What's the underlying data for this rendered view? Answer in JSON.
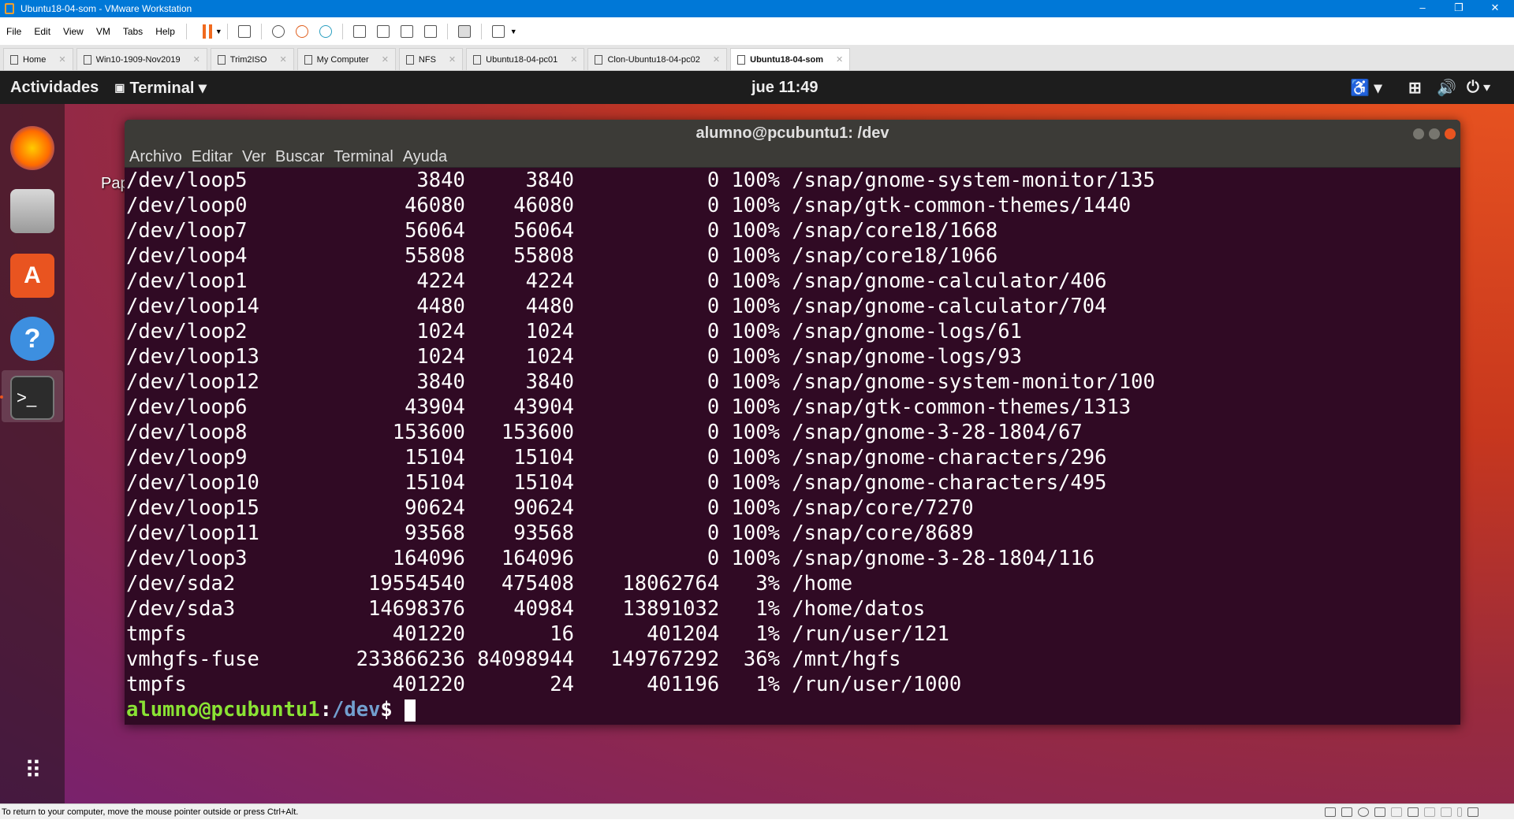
{
  "window": {
    "title": "Ubuntu18-04-som - VMware Workstation"
  },
  "menu": [
    "File",
    "Edit",
    "View",
    "VM",
    "Tabs",
    "Help"
  ],
  "tabs": [
    {
      "label": "Home"
    },
    {
      "label": "Win10-1909-Nov2019"
    },
    {
      "label": "Trim2ISO"
    },
    {
      "label": "My Computer"
    },
    {
      "label": "NFS"
    },
    {
      "label": "Ubuntu18-04-pc01"
    },
    {
      "label": "Clon-Ubuntu18-04-pc02"
    },
    {
      "label": "Ubuntu18-04-som",
      "active": true
    }
  ],
  "topbar": {
    "activities": "Actividades",
    "app": "Terminal ▾",
    "clock": "jue 11:49"
  },
  "desktop": {
    "icon_label": "Pap"
  },
  "terminal": {
    "title": "alumno@pcubuntu1: /dev",
    "menu": [
      "Archivo",
      "Editar",
      "Ver",
      "Buscar",
      "Terminal",
      "Ayuda"
    ],
    "rows": [
      [
        "/dev/loop5",
        "3840",
        "3840",
        "0",
        "100%",
        "/snap/gnome-system-monitor/135"
      ],
      [
        "/dev/loop0",
        "46080",
        "46080",
        "0",
        "100%",
        "/snap/gtk-common-themes/1440"
      ],
      [
        "/dev/loop7",
        "56064",
        "56064",
        "0",
        "100%",
        "/snap/core18/1668"
      ],
      [
        "/dev/loop4",
        "55808",
        "55808",
        "0",
        "100%",
        "/snap/core18/1066"
      ],
      [
        "/dev/loop1",
        "4224",
        "4224",
        "0",
        "100%",
        "/snap/gnome-calculator/406"
      ],
      [
        "/dev/loop14",
        "4480",
        "4480",
        "0",
        "100%",
        "/snap/gnome-calculator/704"
      ],
      [
        "/dev/loop2",
        "1024",
        "1024",
        "0",
        "100%",
        "/snap/gnome-logs/61"
      ],
      [
        "/dev/loop13",
        "1024",
        "1024",
        "0",
        "100%",
        "/snap/gnome-logs/93"
      ],
      [
        "/dev/loop12",
        "3840",
        "3840",
        "0",
        "100%",
        "/snap/gnome-system-monitor/100"
      ],
      [
        "/dev/loop6",
        "43904",
        "43904",
        "0",
        "100%",
        "/snap/gtk-common-themes/1313"
      ],
      [
        "/dev/loop8",
        "153600",
        "153600",
        "0",
        "100%",
        "/snap/gnome-3-28-1804/67"
      ],
      [
        "/dev/loop9",
        "15104",
        "15104",
        "0",
        "100%",
        "/snap/gnome-characters/296"
      ],
      [
        "/dev/loop10",
        "15104",
        "15104",
        "0",
        "100%",
        "/snap/gnome-characters/495"
      ],
      [
        "/dev/loop15",
        "90624",
        "90624",
        "0",
        "100%",
        "/snap/core/7270"
      ],
      [
        "/dev/loop11",
        "93568",
        "93568",
        "0",
        "100%",
        "/snap/core/8689"
      ],
      [
        "/dev/loop3",
        "164096",
        "164096",
        "0",
        "100%",
        "/snap/gnome-3-28-1804/116"
      ],
      [
        "/dev/sda2",
        "19554540",
        "475408",
        "18062764",
        "3%",
        "/home"
      ],
      [
        "/dev/sda3",
        "14698376",
        "40984",
        "13891032",
        "1%",
        "/home/datos"
      ],
      [
        "tmpfs",
        "401220",
        "16",
        "401204",
        "1%",
        "/run/user/121"
      ],
      [
        "vmhgfs-fuse",
        "233866236",
        "84098944",
        "149767292",
        "36%",
        "/mnt/hgfs"
      ],
      [
        "tmpfs",
        "401220",
        "24",
        "401196",
        "1%",
        "/run/user/1000"
      ]
    ],
    "prompt": {
      "user": "alumno@pcubuntu1",
      "sep": ":",
      "path": "/dev",
      "symbol": "$ "
    }
  },
  "statusbar": {
    "text": "To return to your computer, move the mouse pointer outside or press Ctrl+Alt."
  }
}
